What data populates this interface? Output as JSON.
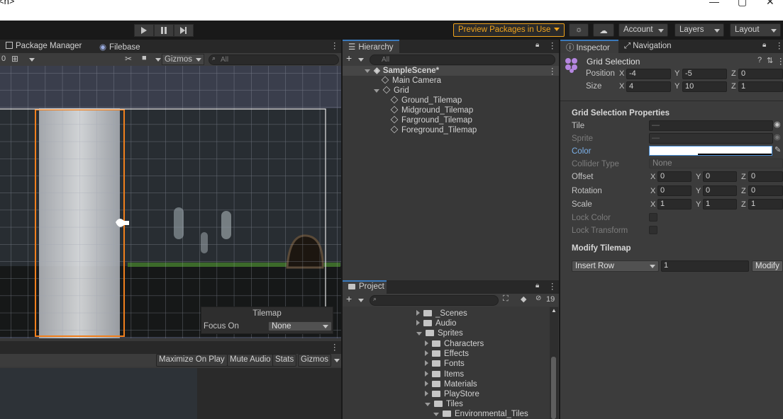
{
  "window": {
    "title_fragment": "<n>"
  },
  "toolbar": {
    "preview_packages": "Preview Packages in Use",
    "account": "Account",
    "layers": "Layers",
    "layout": "Layout"
  },
  "scene_panel": {
    "tabs": [
      "Package Manager",
      "Filebase"
    ],
    "zoom_value": "0",
    "gizmos": "Gizmos",
    "search_placeholder": "All",
    "tilemap_overlay": {
      "title": "Tilemap",
      "focus_label": "Focus On",
      "focus_value": "None"
    }
  },
  "game_panel": {
    "buttons": [
      "Maximize On Play",
      "Mute Audio",
      "Stats",
      "Gizmos"
    ]
  },
  "hierarchy": {
    "tab": "Hierarchy",
    "search_placeholder": "All",
    "items": [
      {
        "label": "SampleScene*",
        "depth": 0
      },
      {
        "label": "Main Camera",
        "depth": 1
      },
      {
        "label": "Grid",
        "depth": 1
      },
      {
        "label": "Ground_Tilemap",
        "depth": 2
      },
      {
        "label": "Midground_Tilemap",
        "depth": 2
      },
      {
        "label": "Farground_Tilemap",
        "depth": 2
      },
      {
        "label": "Foreground_Tilemap",
        "depth": 2
      }
    ]
  },
  "project": {
    "tab": "Project",
    "hidden_count": "19",
    "items": [
      {
        "label": "_Scenes",
        "depth": 0,
        "open": false
      },
      {
        "label": "Audio",
        "depth": 0,
        "open": false
      },
      {
        "label": "Sprites",
        "depth": 0,
        "open": true
      },
      {
        "label": "Characters",
        "depth": 1,
        "open": false
      },
      {
        "label": "Effects",
        "depth": 1,
        "open": false
      },
      {
        "label": "Fonts",
        "depth": 1,
        "open": false
      },
      {
        "label": "Items",
        "depth": 1,
        "open": false
      },
      {
        "label": "Materials",
        "depth": 1,
        "open": false
      },
      {
        "label": "PlayStore",
        "depth": 1,
        "open": false
      },
      {
        "label": "Tiles",
        "depth": 1,
        "open": true
      },
      {
        "label": "Environmental_Tiles",
        "depth": 2,
        "open": true
      }
    ]
  },
  "inspector": {
    "tabs": [
      "Inspector",
      "Navigation"
    ],
    "object_name": "Grid Selection",
    "position": {
      "label": "Position",
      "x": "-4",
      "y": "-5",
      "z": "0"
    },
    "size": {
      "label": "Size",
      "x": "4",
      "y": "10",
      "z": "1"
    },
    "properties_header": "Grid Selection Properties",
    "tile_label": "Tile",
    "tile_value": "—",
    "sprite_label": "Sprite",
    "sprite_value": "—",
    "color_label": "Color",
    "collider_label": "Collider Type",
    "collider_value": "None",
    "offset": {
      "label": "Offset",
      "x": "0",
      "y": "0",
      "z": "0"
    },
    "rotation": {
      "label": "Rotation",
      "x": "0",
      "y": "0",
      "z": "0"
    },
    "scale": {
      "label": "Scale",
      "x": "1",
      "y": "1",
      "z": "1"
    },
    "lock_color": "Lock Color",
    "lock_transform": "Lock Transform",
    "modify_header": "Modify Tilemap",
    "modify_op": "Insert Row",
    "modify_count": "1",
    "modify_button": "Modify",
    "axis_x": "X",
    "axis_y": "Y",
    "axis_z": "Z"
  },
  "colors": {
    "accent": "#3a79bb",
    "selection_orange": "#f07f1c",
    "preview_border": "#f0a31b"
  }
}
